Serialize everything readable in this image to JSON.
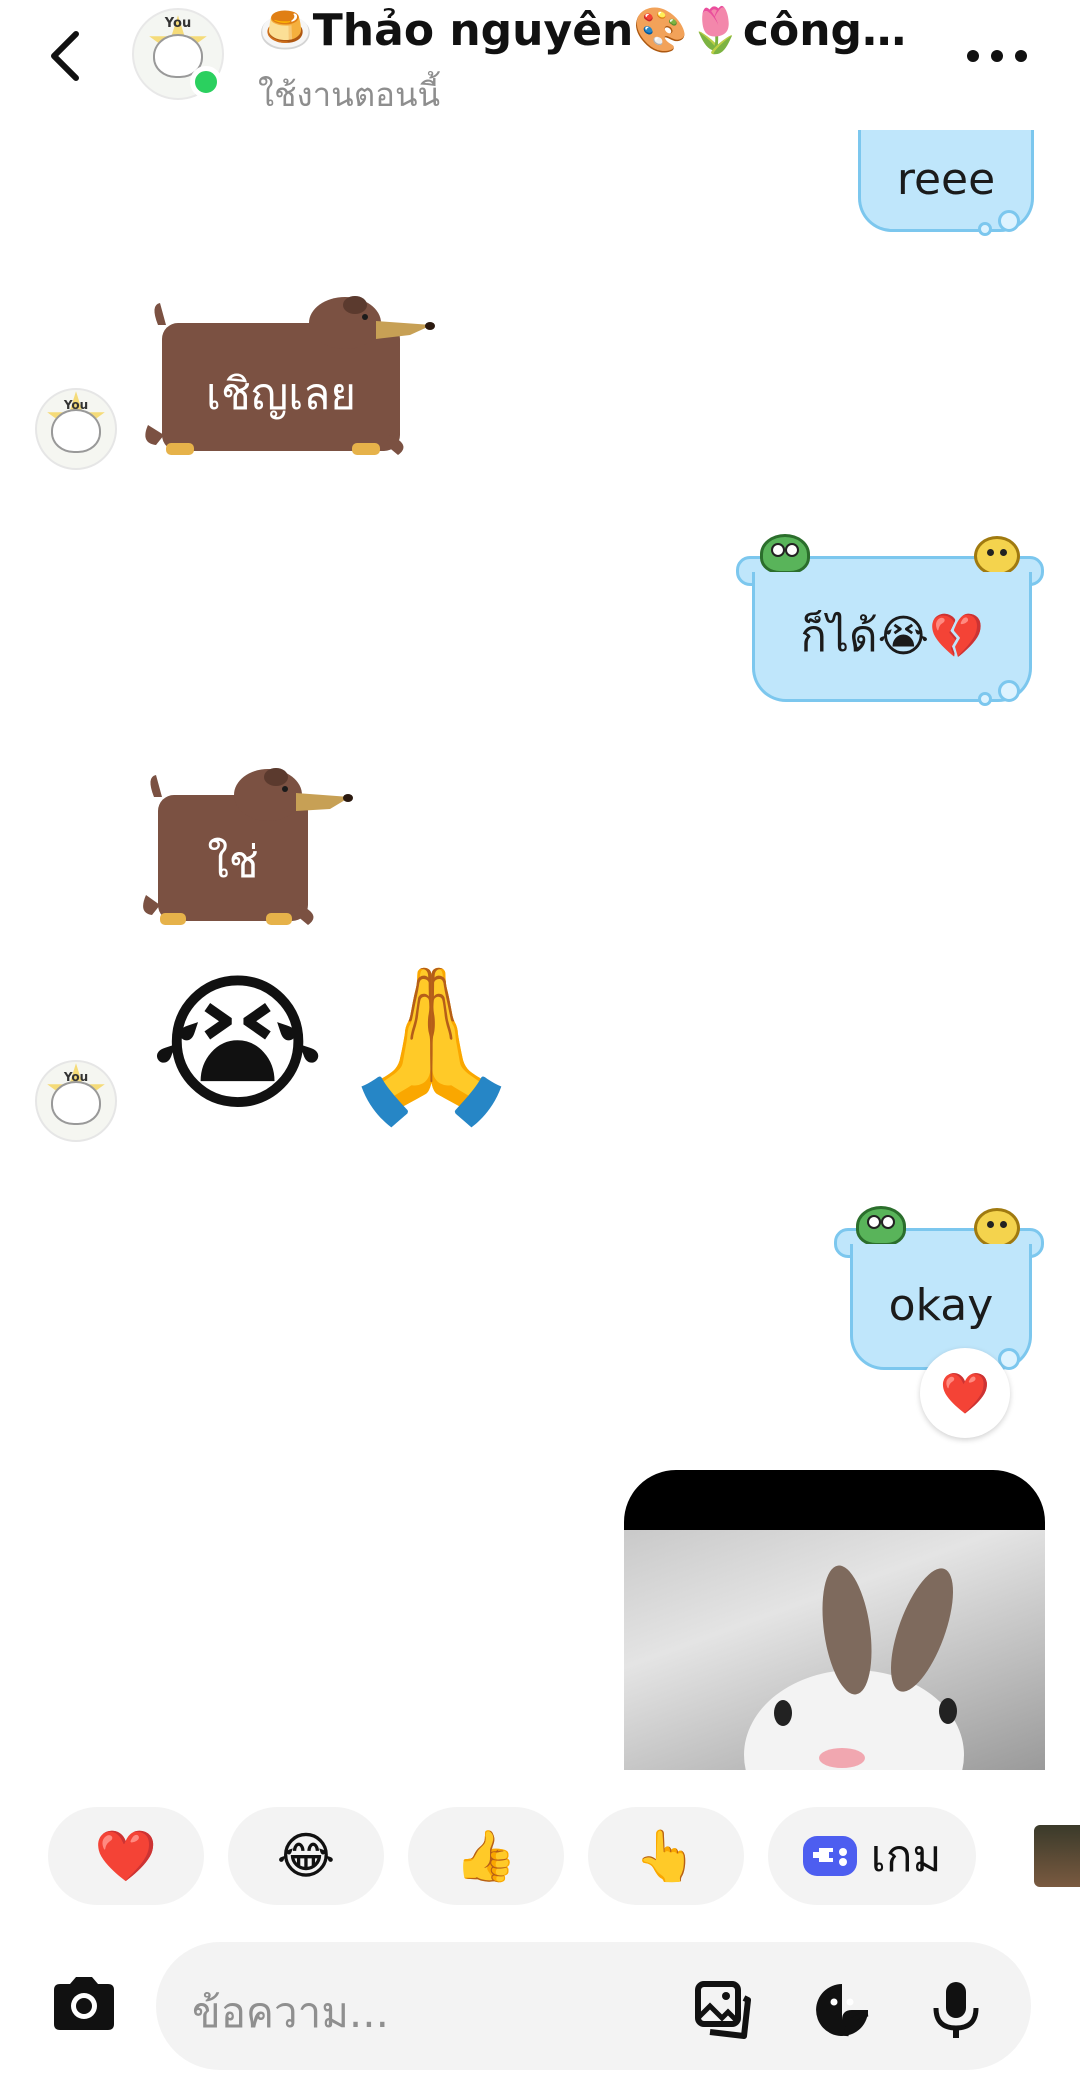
{
  "header": {
    "title": "🍮Thảo nguyên🎨🌷công t…",
    "status": "ใช้งานตอนนี้",
    "avatar_caption": "You"
  },
  "messages": {
    "m1": {
      "text": "reee"
    },
    "m2": {
      "sticker_text": "เชิญเลย",
      "avatar_caption": "You"
    },
    "m3": {
      "text": "ก็ได้😭💔"
    },
    "m4": {
      "sticker_text": "ใช่"
    },
    "m5": {
      "emoji_a": "😭",
      "emoji_b": "🙏",
      "avatar_caption": "You"
    },
    "m6": {
      "text": "okay",
      "reaction": "❤️"
    }
  },
  "quick_replies": {
    "heart": "❤️",
    "laugh": "😂",
    "thumbs": "👍",
    "point": "👆",
    "game_label": "เกม"
  },
  "composer": {
    "placeholder": "ข้อความ..."
  },
  "colors": {
    "bubble": "#bfe6fb",
    "bubble_border": "#7cc7ee",
    "dog": "#7b5142",
    "online": "#2bd05f",
    "game": "#4d5ef0"
  }
}
